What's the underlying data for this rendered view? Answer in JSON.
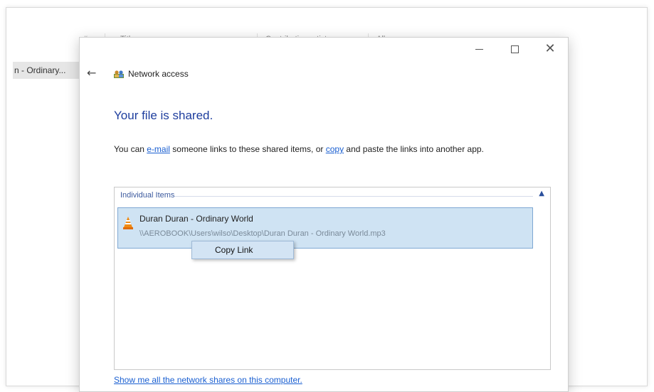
{
  "background_window": {
    "columns": [
      "#",
      "Title",
      "Contributing artists",
      "Album"
    ],
    "selected_row": "n - Ordinary..."
  },
  "dialog": {
    "breadcrumb": "Network access",
    "heading": "Your file is shared.",
    "description": {
      "prefix": "You can ",
      "email_link": "e-mail",
      "middle": " someone links to these shared items, or ",
      "copy_link": "copy",
      "suffix": " and paste the links into another app."
    },
    "panel_title": "Individual Items",
    "item": {
      "name": "Duran Duran - Ordinary World",
      "path": "\\\\AEROBOOK\\Users\\wilso\\Desktop\\Duran Duran - Ordinary World.mp3"
    },
    "context_menu": [
      "Copy Link"
    ],
    "bottom_link": "Show me all the network shares on this computer."
  },
  "colors": {
    "heading": "#1e3e9e",
    "link": "#1a5fd1",
    "selection": "#cfe3f3",
    "selection_border": "#7ea8d3"
  },
  "icons": [
    "back-arrow-icon",
    "network-icon",
    "vlc-icon",
    "minimize-icon",
    "maximize-icon",
    "close-icon",
    "chevron-up-icon"
  ]
}
